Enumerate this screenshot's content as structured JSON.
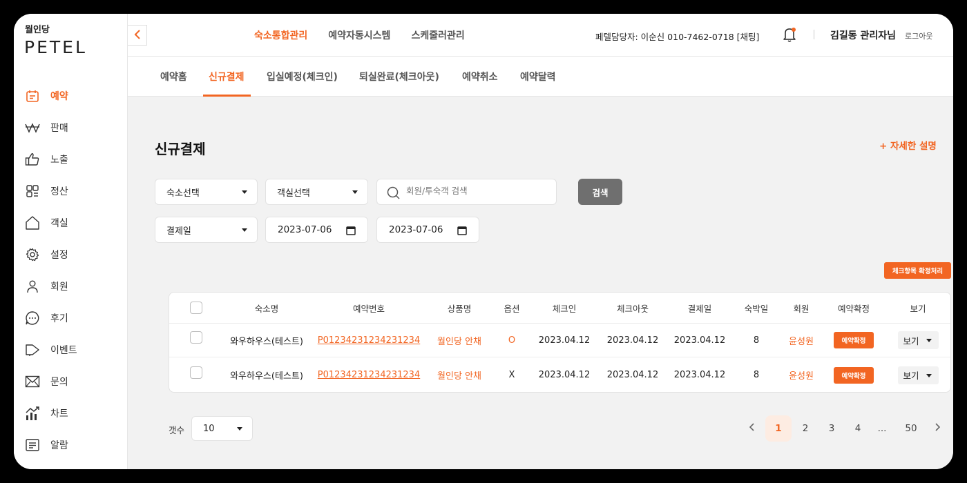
{
  "sidebar": {
    "logo_small": "월인당",
    "logo_big": "PETEL",
    "items": [
      {
        "label": "예약",
        "icon": "calendar-icon",
        "active": true
      },
      {
        "label": "판매",
        "icon": "won-icon"
      },
      {
        "label": "노출",
        "icon": "thumbs-up-icon"
      },
      {
        "label": "정산",
        "icon": "settlement-icon"
      },
      {
        "label": "객실",
        "icon": "home-icon"
      },
      {
        "label": "설정",
        "icon": "gear-icon"
      },
      {
        "label": "회원",
        "icon": "user-icon"
      },
      {
        "label": "후기",
        "icon": "chat-icon"
      },
      {
        "label": "이벤트",
        "icon": "megaphone-icon"
      },
      {
        "label": "문의",
        "icon": "mail-icon"
      },
      {
        "label": "차트",
        "icon": "chart-icon"
      },
      {
        "label": "알람",
        "icon": "list-icon"
      }
    ]
  },
  "header": {
    "nav": [
      "숙소통합관리",
      "예약자동시스템",
      "스케줄러관리"
    ],
    "manager": "페텔담당자: 이순신 010-7462-0718 [채팅]",
    "username": "김길동 관리자님",
    "logout": "로그아웃"
  },
  "subtabs": [
    "예약홈",
    "신규결제",
    "입실예정(체크인)",
    "퇴실완료(체크아웃)",
    "예약취소",
    "예약달력"
  ],
  "page": {
    "title": "신규결제",
    "detail_link": "+ 자세한 설명"
  },
  "filters": {
    "accommodation": "숙소선택",
    "room": "객실선택",
    "search_placeholder": "회원/투숙객 검색",
    "search_button": "검색",
    "date_type": "결제일",
    "date_from": "2023-07-06",
    "date_to": "2023-07-06"
  },
  "confirm_all_button": "체크항목 확정처리",
  "table": {
    "headers": [
      "숙소명",
      "예약번호",
      "상품명",
      "옵션",
      "체크인",
      "체크아웃",
      "결제일",
      "숙박일",
      "회원",
      "예약확정",
      "보기"
    ],
    "rows": [
      {
        "name": "와우하우스(테스트)",
        "number": "P01234231234231234",
        "product": "월인당 안채",
        "option": "O",
        "checkin": "2023.04.12",
        "checkout": "2023.04.12",
        "paid": "2023.04.12",
        "nights": "8",
        "member": "윤성원",
        "confirm": "예약확정",
        "view": "보기"
      },
      {
        "name": "와우하우스(테스트)",
        "number": "P01234231234231234",
        "product": "월인당 안채",
        "option": "X",
        "checkin": "2023.04.12",
        "checkout": "2023.04.12",
        "paid": "2023.04.12",
        "nights": "8",
        "member": "윤성원",
        "confirm": "예약확정",
        "view": "보기"
      }
    ]
  },
  "footer": {
    "count_label": "갯수",
    "count_value": "10",
    "pages": [
      "1",
      "2",
      "3",
      "4",
      "...",
      "50"
    ],
    "current_page": "1"
  },
  "colors": {
    "accent": "#f26522",
    "search_button": "#6f6f6f"
  }
}
